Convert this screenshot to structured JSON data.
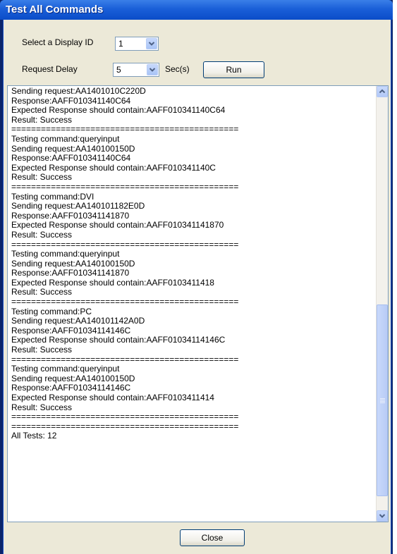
{
  "window": {
    "title": "Test All Commands"
  },
  "display_id": {
    "label": "Select a Display ID",
    "value": "1"
  },
  "request_delay": {
    "label": "Request Delay",
    "value": "5",
    "unit": "Sec(s)"
  },
  "buttons": {
    "run": "Run",
    "close": "Close"
  },
  "log": {
    "lines": [
      "Sending request:AA1401010C220D",
      "Response:AAFF010341140C64",
      "Expected Response should contain:AAFF010341140C64",
      "Result: Success",
      "==============================================",
      "Testing command:queryinput",
      "Sending request:AA140100150D",
      "Response:AAFF010341140C64",
      "Expected Response should contain:AAFF010341140C",
      "Result: Success",
      "==============================================",
      "Testing command:DVI",
      "Sending request:AA140101182E0D",
      "Response:AAFF010341141870",
      "Expected Response should contain:AAFF010341141870",
      "Result: Success",
      "==============================================",
      "Testing command:queryinput",
      "Sending request:AA140100150D",
      "Response:AAFF010341141870",
      "Expected Response should contain:AAFF0103411418",
      "Result: Success",
      "==============================================",
      "Testing command:PC",
      "Sending request:AA140101142A0D",
      "Response:AAFF01034114146C",
      "Expected Response should contain:AAFF01034114146C",
      "Result: Success",
      "==============================================",
      "Testing command:queryinput",
      "Sending request:AA140100150D",
      "Response:AAFF01034114146C",
      "Expected Response should contain:AAFF0103411414",
      "Result: Success",
      "==============================================",
      "==============================================",
      "All Tests: 12"
    ]
  },
  "scrollbar": {
    "position": 0.82
  },
  "colors": {
    "titlebar": "#0b4cc8",
    "window_bg": "#ece9d8",
    "border": "#7f9db9"
  },
  "icons": [
    "chevron-down-icon",
    "scroll-up-arrow-icon",
    "scroll-down-arrow-icon"
  ]
}
